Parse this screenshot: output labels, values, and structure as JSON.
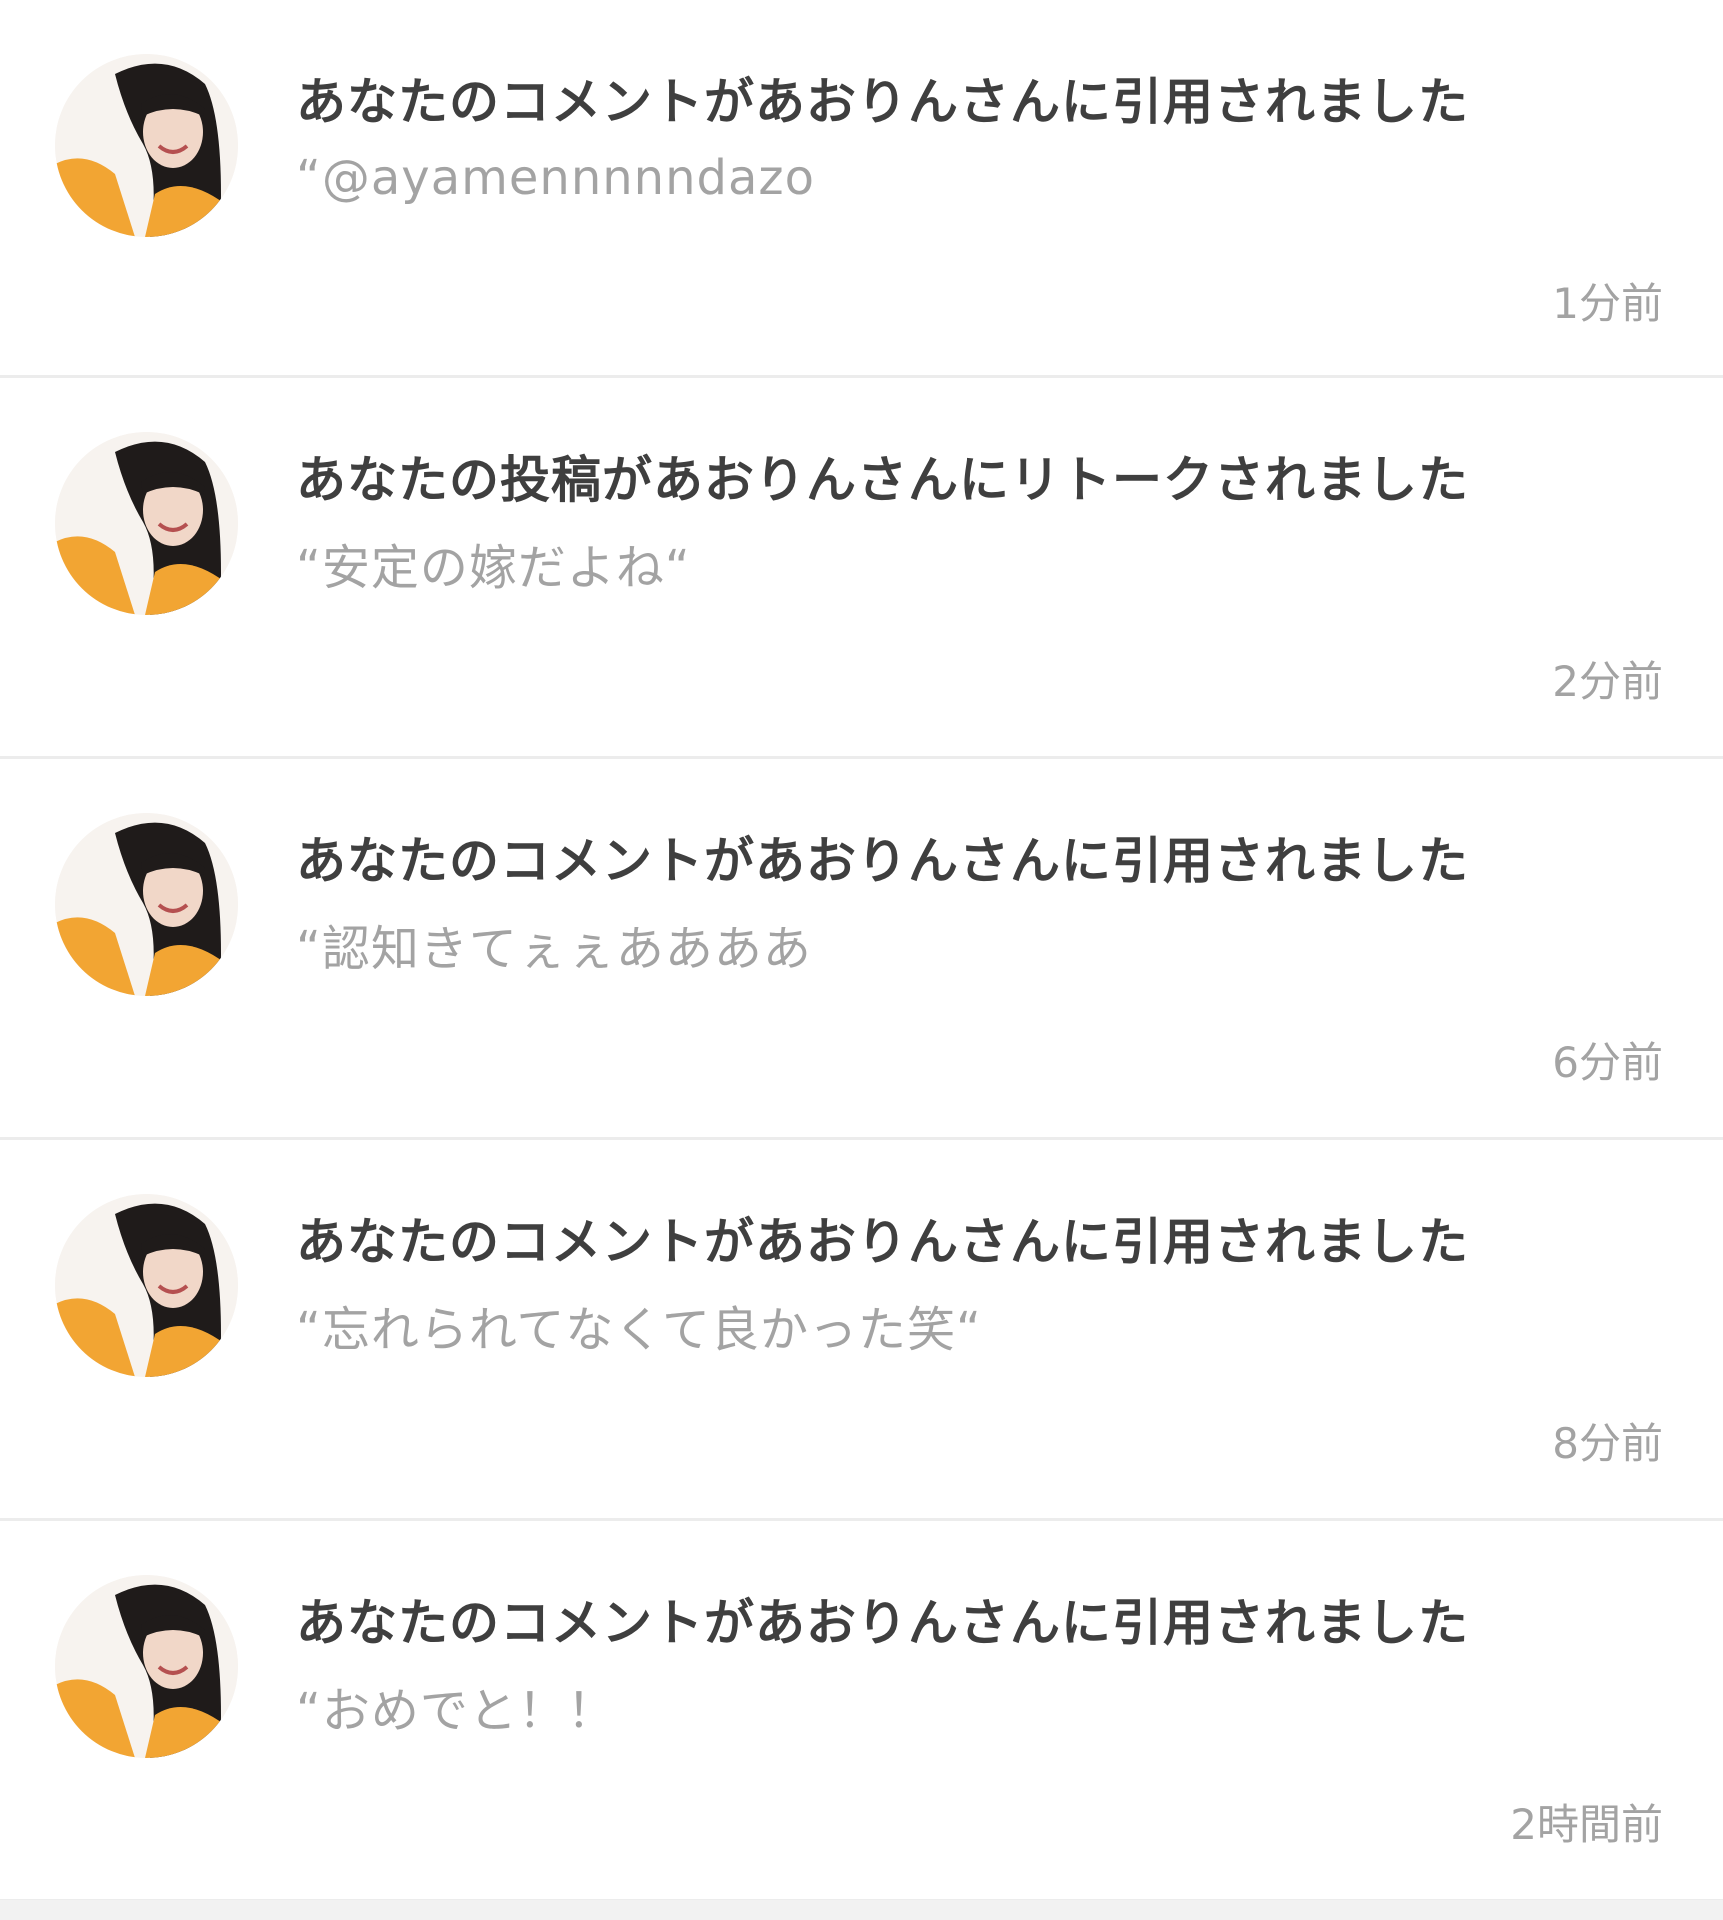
{
  "notifications": [
    {
      "title": "あなたのコメントがあおりんさんに引用されました",
      "excerpt": "“@ayamennnnndazo",
      "time": "1分前",
      "avatar_icon": "user-avatar-photo"
    },
    {
      "title": "あなたの投稿があおりんさんにリトークされました",
      "excerpt": "“安定の嫁だよね“",
      "time": "2分前",
      "avatar_icon": "user-avatar-photo"
    },
    {
      "title": "あなたのコメントがあおりんさんに引用されました",
      "excerpt": "“認知きてぇぇああああ",
      "time": "6分前",
      "avatar_icon": "user-avatar-photo"
    },
    {
      "title": "あなたのコメントがあおりんさんに引用されました",
      "excerpt": "“忘れられてなくて良かった笑“",
      "time": "8分前",
      "avatar_icon": "user-avatar-photo"
    },
    {
      "title": "あなたのコメントがあおりんさんに引用されました",
      "excerpt": "“おめでと！！",
      "time": "2時間前",
      "avatar_icon": "user-avatar-photo"
    }
  ],
  "colors": {
    "title": "#3f3f3f",
    "secondary": "#a3a3a3",
    "divider": "#ececec",
    "avatar_accent": "#f2a533"
  }
}
